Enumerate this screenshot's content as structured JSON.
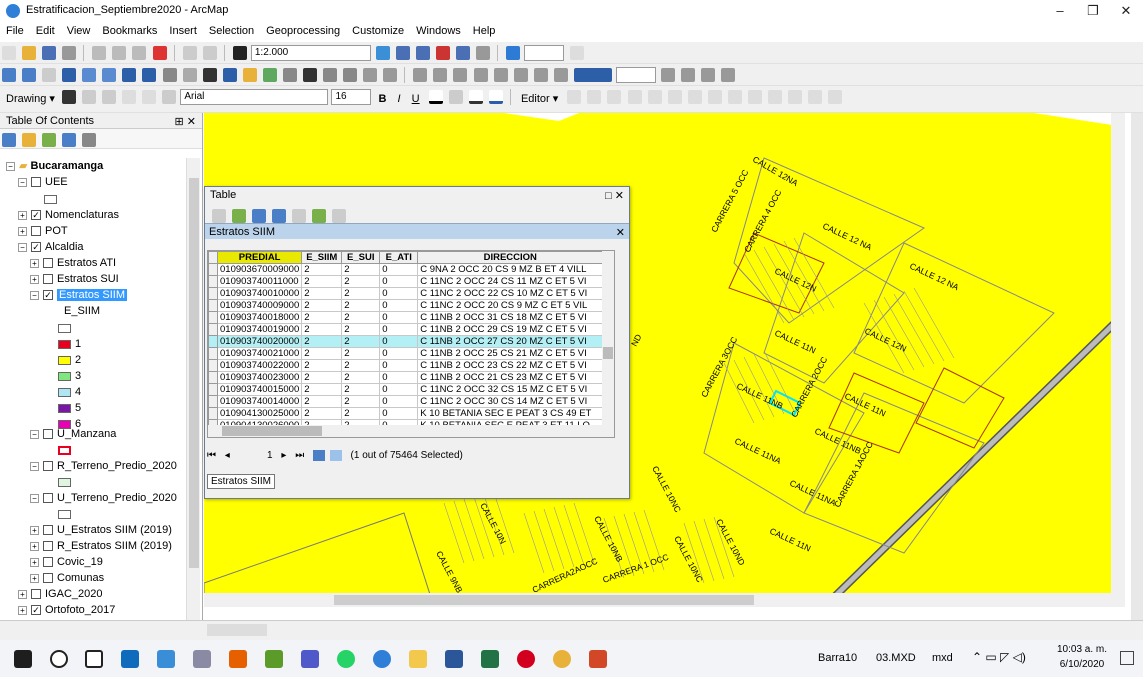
{
  "window": {
    "title": "Estratificacion_Septiembre2020 - ArcMap",
    "minimize": "–",
    "maximize": "❐",
    "close": "✕"
  },
  "menu": [
    "File",
    "Edit",
    "View",
    "Bookmarks",
    "Insert",
    "Selection",
    "Geoprocessing",
    "Customize",
    "Windows",
    "Help"
  ],
  "toolbar": {
    "scale": "1:2.000",
    "drawing_label": "Drawing ▾",
    "font": "Arial",
    "font_size": "16",
    "editor_label": "Editor ▾",
    "bold": "B",
    "italic": "I",
    "underline": "U"
  },
  "toc": {
    "header": "Table Of Contents",
    "pin": "⊞ ✕",
    "items": [
      {
        "label": "Bucaramanga",
        "bold": true
      },
      {
        "label": "UEE"
      },
      {
        "label": "Nomenclaturas",
        "checked": true
      },
      {
        "label": "POT"
      },
      {
        "label": "Alcaldia",
        "checked": true
      },
      {
        "label": "Estratos ATI"
      },
      {
        "label": "Estratos SUI"
      },
      {
        "label": "Estratos SIIM",
        "checked": true,
        "selected": true
      },
      {
        "label": "E_SIIM"
      },
      {
        "label": "U_Manzana"
      },
      {
        "label": "R_Terreno_Predio_2020"
      },
      {
        "label": "U_Terreno_Predio_2020"
      },
      {
        "label": "U_Estratos SIIM (2019)"
      },
      {
        "label": "R_Estratos SIIM (2019)"
      },
      {
        "label": "Covic_19"
      },
      {
        "label": "Comunas"
      },
      {
        "label": "IGAC_2020"
      },
      {
        "label": "Ortofoto_2017",
        "checked": true
      }
    ],
    "legend": [
      {
        "label": "",
        "color": "#ffffff"
      },
      {
        "label": "1",
        "color": "#e8001e"
      },
      {
        "label": "2",
        "color": "#ffff00"
      },
      {
        "label": "3",
        "color": "#7ee87e"
      },
      {
        "label": "4",
        "color": "#aee6f5"
      },
      {
        "label": "5",
        "color": "#7a16a6"
      },
      {
        "label": "6",
        "color": "#e800b4"
      }
    ]
  },
  "table": {
    "window_title": "Table",
    "tab_title": "Estratos SIIM",
    "columns": [
      "PREDIAL",
      "E_SIIM",
      "E_SUI",
      "E_ATI",
      "DIRECCION"
    ],
    "rows": [
      [
        "010903670009000",
        "2",
        "2",
        "0",
        "C 9NA 2 OCC 20 CS 9 MZ B ET 4 VILL"
      ],
      [
        "010903740011000",
        "2",
        "2",
        "0",
        "C 11NC 2 OCC 24 CS 11 MZ C ET 5 VI"
      ],
      [
        "010903740010000",
        "2",
        "2",
        "0",
        "C 11NC 2 OCC 22 CS 10 MZ C ET 5 VI"
      ],
      [
        "010903740009000",
        "2",
        "2",
        "0",
        "C 11NC 2 OCC 20 CS 9 MZ C ET 5 VIL"
      ],
      [
        "010903740018000",
        "2",
        "2",
        "0",
        "C 11NB 2 OCC 31 CS 18 MZ C ET 5 VI"
      ],
      [
        "010903740019000",
        "2",
        "2",
        "0",
        "C 11NB 2 OCC 29 CS 19 MZ C ET 5 VI"
      ],
      [
        "010903740020000",
        "2",
        "2",
        "0",
        "C 11NB 2 OCC 27 CS 20 MZ C ET 5 VI"
      ],
      [
        "010903740021000",
        "2",
        "2",
        "0",
        "C 11NB 2 OCC 25 CS 21 MZ C ET 5 VI"
      ],
      [
        "010903740022000",
        "2",
        "2",
        "0",
        "C 11NB 2 OCC 23 CS 22 MZ C ET 5 VI"
      ],
      [
        "010903740023000",
        "2",
        "2",
        "0",
        "C 11NB 2 OCC 21 CS 23 MZ C ET 5 VI"
      ],
      [
        "010903740015000",
        "2",
        "2",
        "0",
        "C 11NC 2 OCC 32 CS 15 MZ C ET 5 VI"
      ],
      [
        "010903740014000",
        "2",
        "2",
        "0",
        "C 11NC 2 OCC 30 CS 14 MZ C ET 5 VI"
      ],
      [
        "010904130025000",
        "2",
        "2",
        "0",
        "K 10 BETANIA SEC E PEAT 3 CS 49 ET"
      ],
      [
        "010904130026000",
        "2",
        "2",
        "0",
        "K 10 BETANIA SEC E PEAT 3 ET 11 LO"
      ]
    ],
    "highlighted_row": 6,
    "nav": {
      "first": "⏮",
      "prev": "◂",
      "record": "1",
      "next": "▸",
      "last": "⏭"
    },
    "selection_status": "(1 out of 75464 Selected)",
    "bottom_tab": "Estratos SIIM"
  },
  "map_labels": [
    "CALLE 12NA",
    "CARRERA 5 OCC",
    "CARRERA 4 OCC",
    "CALLE 12 NA",
    "CALLE 12N",
    "CALLE 12 NA",
    "CALLE 11N",
    "CALLE 12N",
    "CARRERA 3OCC",
    "CALLE 11NB",
    "CARRERA 2OCC",
    "CALLE 11N",
    "CALLE 11NB",
    "CALLE 11NA",
    "CALLE 11NA",
    "CARRERA 1AOCC",
    "CALLE 11N",
    "CALLE 10NC",
    "CALLE 10ND",
    "CALLE 10N",
    "CALLE 10NB",
    "CALLE 10NC",
    "CALLE 9NB",
    "CARRERA2AOCC",
    "CARRERA 1 OCC",
    "ND"
  ],
  "taskbar": {
    "items": [
      "Barra10",
      "03.MXD",
      "mxd"
    ],
    "time": "10:03 a. m.",
    "date": "6/10/2020"
  },
  "colors": {
    "map_fill": "#ffff00",
    "highlight_row": "#b3f0f5",
    "selected_parcel": "#00e5ff"
  }
}
